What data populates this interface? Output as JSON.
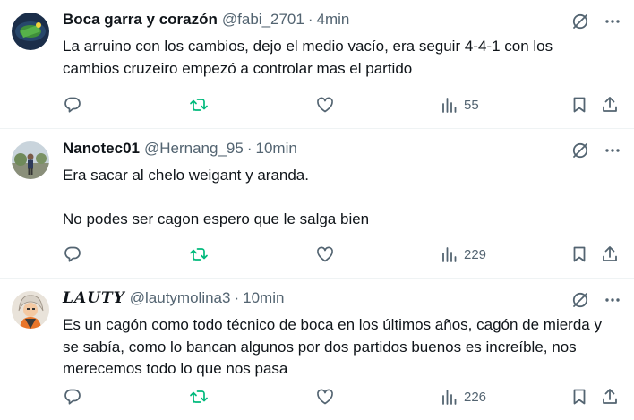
{
  "tweets": [
    {
      "name": "Boca garra y corazón",
      "handle": "@fabi_2701",
      "separator": "·",
      "time": "4min",
      "paragraphs": [
        "La arruino con los cambios, dejo el medio vacío, era seguir 4-4-1 con los cambios cruzeiro empezó a controlar mas el partido"
      ],
      "views": "55"
    },
    {
      "name": "Nanotec01",
      "handle": "@Hernang_95",
      "separator": "·",
      "time": "10min",
      "paragraphs": [
        "Era sacar al chelo weigant y aranda.",
        "No podes ser cagon espero que le salga bien"
      ],
      "views": "229"
    },
    {
      "name": "LAUTY",
      "handle": "@lautymolina3",
      "separator": "·",
      "time": "10min",
      "paragraphs": [
        "Es un cagón como todo técnico de boca en los últimos años, cagón de mierda y se sabía, como lo bancan algunos por dos partidos buenos es increíble, nos merecemos todo lo que nos pasa"
      ],
      "views": "226"
    }
  ],
  "icons": {
    "reply": "reply-icon",
    "retweet": "retweet-icon",
    "like": "heart-icon",
    "views": "views-bar-chart-icon",
    "bookmark": "bookmark-icon",
    "share": "share-icon",
    "grok": "grok-slash-icon",
    "more": "more-dots-icon"
  },
  "colors": {
    "text": "#0f1419",
    "secondary": "#536471",
    "divider": "#eff3f4",
    "retweet_icon": "#00ba7c"
  }
}
